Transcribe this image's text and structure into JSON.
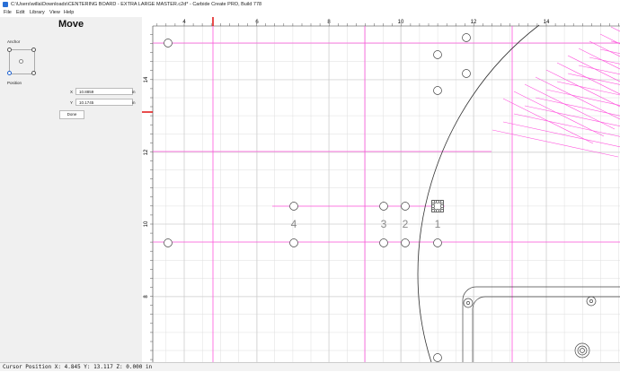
{
  "window": {
    "title": "C:\\Users\\willa\\Downloads\\CENTERING BOARD - EXTRA LARGE MASTER.c2d* - Carbide Create PRO, Build 778"
  },
  "menu": [
    {
      "label": "File"
    },
    {
      "label": "Edit"
    },
    {
      "label": "Library"
    },
    {
      "label": "View"
    },
    {
      "label": "Help"
    }
  ],
  "panel": {
    "title": "Move",
    "anchor_label": "Anchor",
    "anchor_selected": "bottom-left",
    "position_label": "Position",
    "x_label": "X",
    "x_value": "10.8859",
    "y_label": "Y",
    "y_value": "10.1745",
    "unit": "in",
    "done_label": "Done"
  },
  "canvas": {
    "x_ticks": [
      "4",
      "6",
      "8",
      "10",
      "12",
      "14"
    ],
    "y_ticks": [
      "14",
      "12",
      "10",
      "8"
    ],
    "hole_labels": [
      "4",
      "3",
      "2",
      "1"
    ],
    "colors": {
      "grid": "#d8d8d8",
      "guide": "#ff55dd",
      "ruler_marker": "#e01010"
    }
  },
  "status": {
    "text": "Cursor Position X: 4.845 Y: 13.117 Z: 0.000 in"
  }
}
